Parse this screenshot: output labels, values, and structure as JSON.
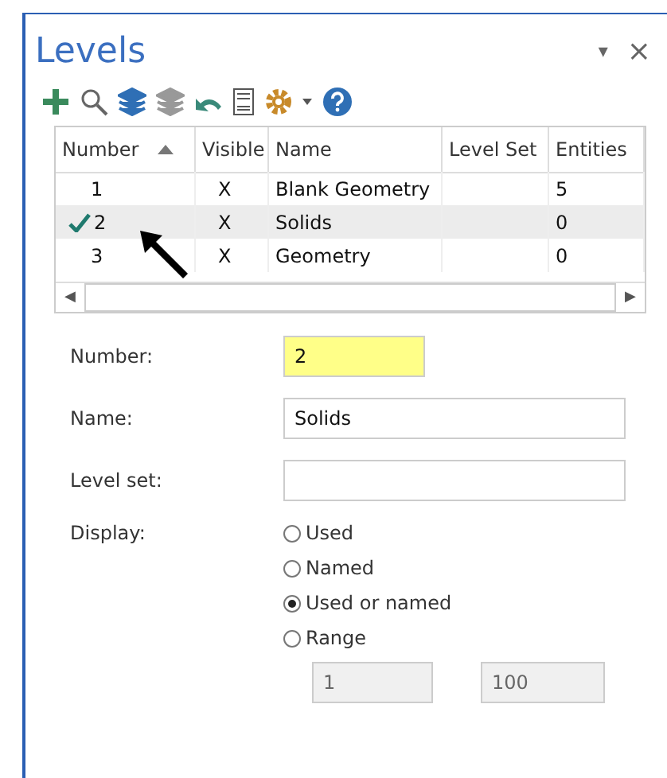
{
  "panel": {
    "title": "Levels",
    "menu_glyph": "▾",
    "close_glyph": "×"
  },
  "table": {
    "columns": [
      {
        "label": "Number",
        "sorted": true
      },
      {
        "label": "Visible",
        "sorted": false
      },
      {
        "label": "Name",
        "sorted": false
      },
      {
        "label": "Level Set",
        "sorted": false
      },
      {
        "label": "Entities",
        "sorted": false
      }
    ],
    "rows": [
      {
        "number": "1",
        "visible": "X",
        "name": "Blank Geometry",
        "level_set": "",
        "entities": "5",
        "selected": false,
        "current": false
      },
      {
        "number": "2",
        "visible": "X",
        "name": "Solids",
        "level_set": "",
        "entities": "0",
        "selected": true,
        "current": true
      },
      {
        "number": "3",
        "visible": "X",
        "name": "Geometry",
        "level_set": "",
        "entities": "0",
        "selected": false,
        "current": false
      }
    ],
    "scroll_left": "◀",
    "scroll_right": "▶"
  },
  "form": {
    "number_label": "Number:",
    "number_value": "2",
    "name_label": "Name:",
    "name_value": "Solids",
    "level_set_label": "Level set:",
    "display_label": "Display:",
    "display_options": [
      {
        "label": "Used",
        "selected": false
      },
      {
        "label": "Named",
        "selected": false
      },
      {
        "label": "Used or named",
        "selected": true
      },
      {
        "label": "Range",
        "selected": false
      }
    ],
    "range_from": "1",
    "range_to": "100"
  }
}
